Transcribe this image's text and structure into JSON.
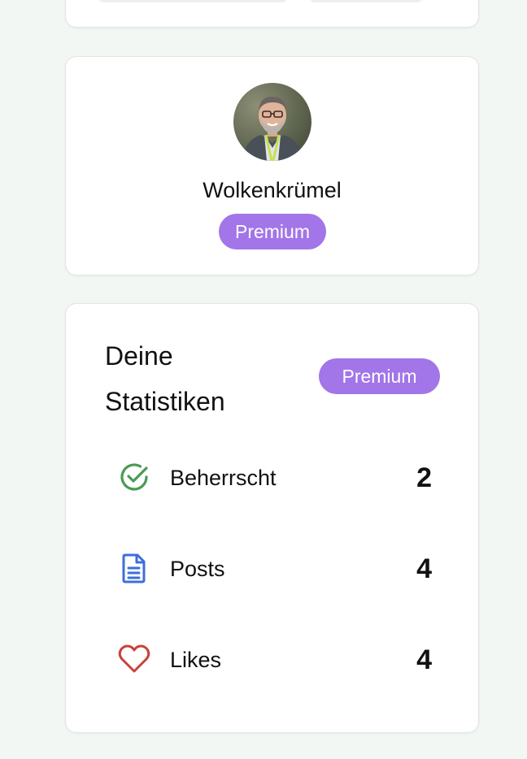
{
  "profile": {
    "username": "Wolkenkrümel",
    "badge": "Premium",
    "avatar_alt": "profile photo"
  },
  "stats": {
    "title": "Deine Statistiken",
    "badge": "Premium",
    "items": [
      {
        "label": "Beherrscht",
        "value": "2",
        "icon": "check-circle-icon",
        "color": "#4a9a52"
      },
      {
        "label": "Posts",
        "value": "4",
        "icon": "document-icon",
        "color": "#3d6fd9"
      },
      {
        "label": "Likes",
        "value": "4",
        "icon": "heart-icon",
        "color": "#c9403a"
      }
    ]
  },
  "colors": {
    "background": "#f2f7f3",
    "badge": "#a275e8",
    "card": "#ffffff"
  }
}
